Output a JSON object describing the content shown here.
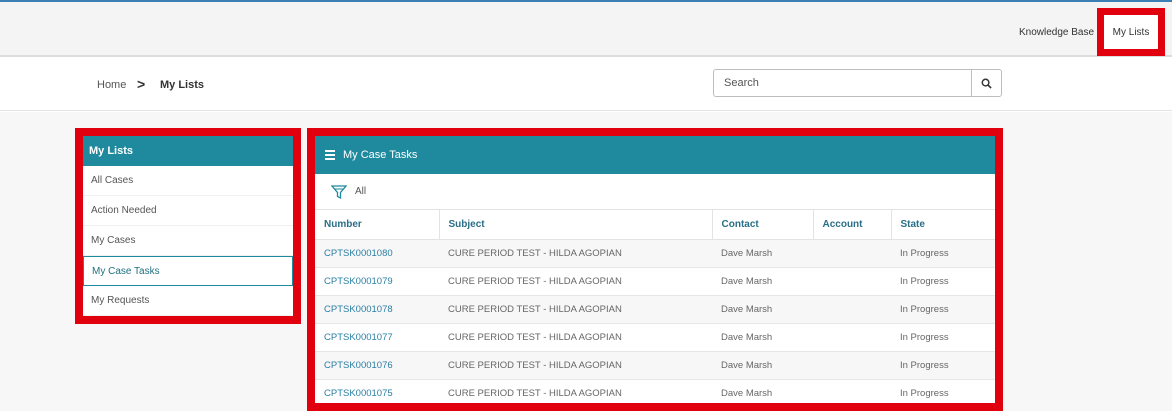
{
  "top_nav": {
    "knowledge_base": "Knowledge Base",
    "my_lists": "My Lists"
  },
  "breadcrumb": {
    "home": "Home",
    "separator": ">",
    "current": "My Lists"
  },
  "search": {
    "placeholder": "Search"
  },
  "sidebar": {
    "title": "My Lists",
    "items": [
      {
        "label": "All Cases"
      },
      {
        "label": "Action Needed"
      },
      {
        "label": "My Cases"
      },
      {
        "label": "My Case Tasks",
        "active": true
      },
      {
        "label": "My Requests"
      }
    ]
  },
  "main": {
    "title": "My Case Tasks",
    "filter_label": "All",
    "columns": [
      "Number",
      "Subject",
      "Contact",
      "Account",
      "State"
    ],
    "rows": [
      {
        "number": "CPTSK0001080",
        "subject": "CURE PERIOD TEST - HILDA AGOPIAN",
        "contact": "Dave Marsh",
        "account": "",
        "state": "In Progress"
      },
      {
        "number": "CPTSK0001079",
        "subject": "CURE PERIOD TEST - HILDA AGOPIAN",
        "contact": "Dave Marsh",
        "account": "",
        "state": "In Progress"
      },
      {
        "number": "CPTSK0001078",
        "subject": "CURE PERIOD TEST - HILDA AGOPIAN",
        "contact": "Dave Marsh",
        "account": "",
        "state": "In Progress"
      },
      {
        "number": "CPTSK0001077",
        "subject": "CURE PERIOD TEST - HILDA AGOPIAN",
        "contact": "Dave Marsh",
        "account": "",
        "state": "In Progress"
      },
      {
        "number": "CPTSK0001076",
        "subject": "CURE PERIOD TEST - HILDA AGOPIAN",
        "contact": "Dave Marsh",
        "account": "",
        "state": "In Progress"
      },
      {
        "number": "CPTSK0001075",
        "subject": "CURE PERIOD TEST - HILDA AGOPIAN",
        "contact": "Dave Marsh",
        "account": "",
        "state": "In Progress"
      }
    ]
  },
  "colors": {
    "header_teal": "#1f8a9e",
    "highlight_red": "#e0000e",
    "link_blue": "#2a7fa5"
  }
}
